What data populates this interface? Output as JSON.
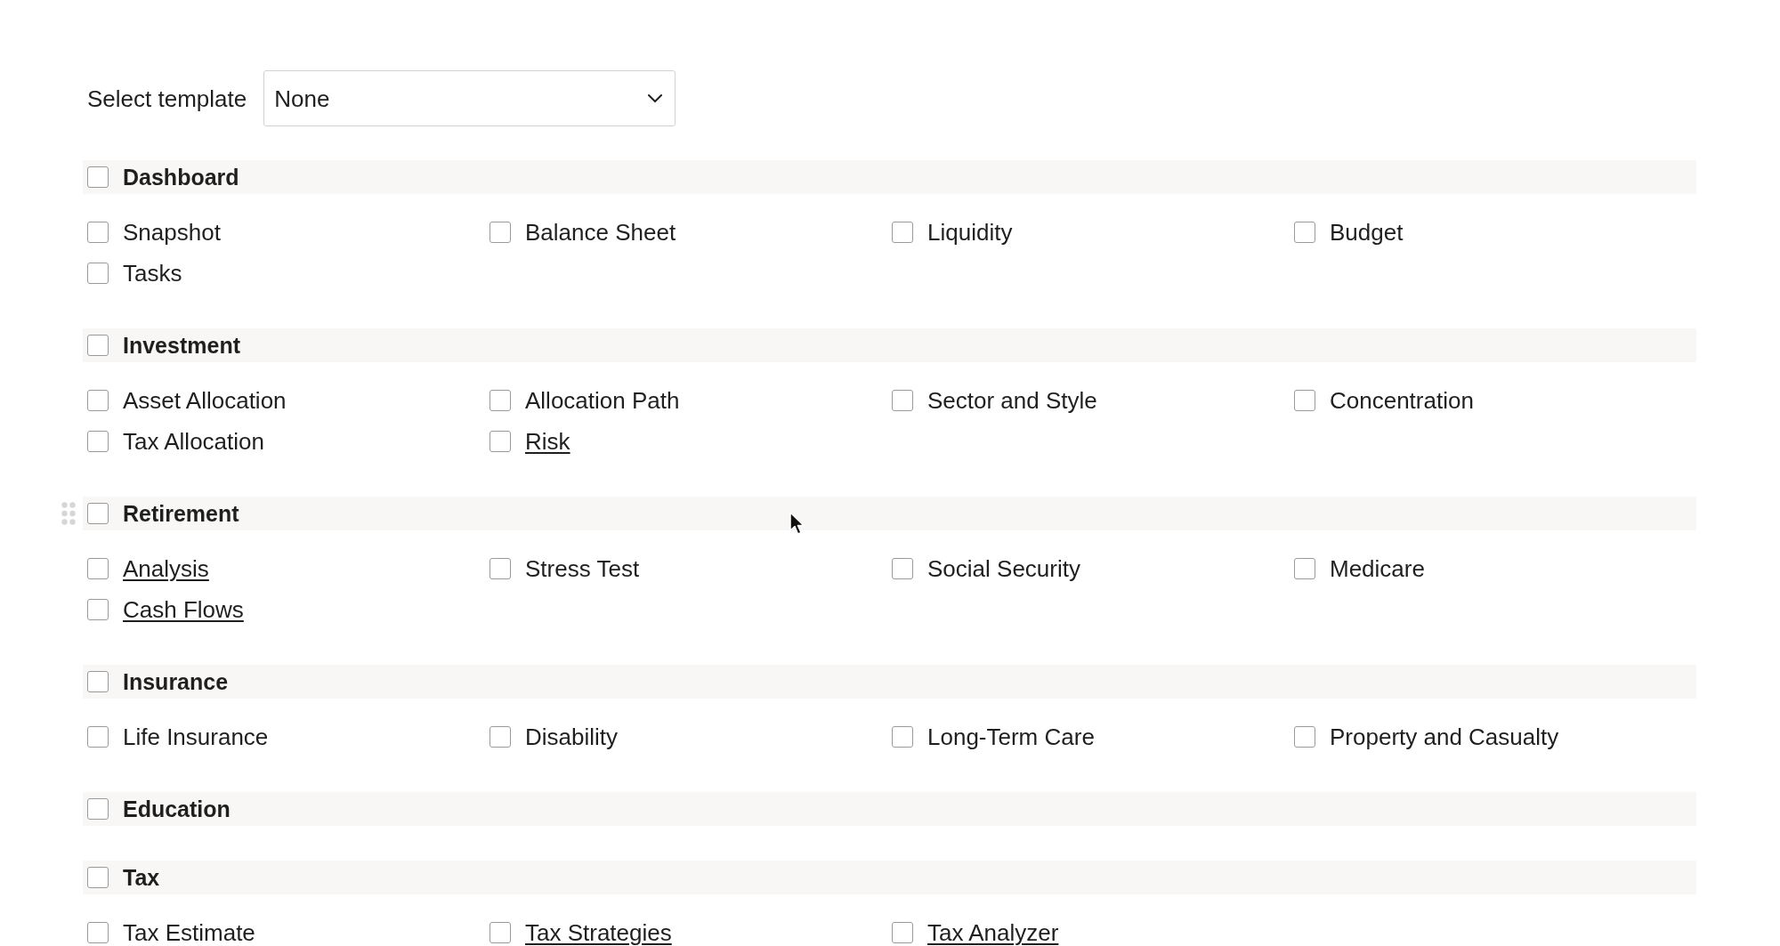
{
  "template": {
    "label": "Select template",
    "value": "None"
  },
  "sections": [
    {
      "title": "Dashboard",
      "checked": false,
      "hovered": false,
      "items": [
        {
          "label": "Snapshot",
          "checked": false,
          "linked": false
        },
        {
          "label": "Balance Sheet",
          "checked": false,
          "linked": false
        },
        {
          "label": "Liquidity",
          "checked": false,
          "linked": false
        },
        {
          "label": "Budget",
          "checked": false,
          "linked": false
        },
        {
          "label": "Tasks",
          "checked": false,
          "linked": false
        }
      ]
    },
    {
      "title": "Investment",
      "checked": false,
      "hovered": false,
      "items": [
        {
          "label": "Asset Allocation",
          "checked": false,
          "linked": false
        },
        {
          "label": "Allocation Path",
          "checked": false,
          "linked": false
        },
        {
          "label": "Sector and Style",
          "checked": false,
          "linked": false
        },
        {
          "label": "Concentration",
          "checked": false,
          "linked": false
        },
        {
          "label": "Tax Allocation",
          "checked": false,
          "linked": false
        },
        {
          "label": "Risk",
          "checked": false,
          "linked": true
        }
      ]
    },
    {
      "title": "Retirement",
      "checked": false,
      "hovered": true,
      "items": [
        {
          "label": "Analysis",
          "checked": false,
          "linked": true
        },
        {
          "label": "Stress Test",
          "checked": false,
          "linked": false
        },
        {
          "label": "Social Security",
          "checked": false,
          "linked": false
        },
        {
          "label": "Medicare",
          "checked": false,
          "linked": false
        },
        {
          "label": "Cash Flows",
          "checked": false,
          "linked": true
        }
      ]
    },
    {
      "title": "Insurance",
      "checked": false,
      "hovered": false,
      "items": [
        {
          "label": "Life Insurance",
          "checked": false,
          "linked": false
        },
        {
          "label": "Disability",
          "checked": false,
          "linked": false
        },
        {
          "label": "Long-Term Care",
          "checked": false,
          "linked": false
        },
        {
          "label": "Property and Casualty",
          "checked": false,
          "linked": false
        }
      ]
    },
    {
      "title": "Education",
      "checked": false,
      "hovered": false
    },
    {
      "title": "Tax",
      "checked": false,
      "hovered": false,
      "items": [
        {
          "label": "Tax Estimate",
          "checked": false,
          "linked": false
        },
        {
          "label": "Tax Strategies",
          "checked": false,
          "linked": true
        },
        {
          "label": "Tax Analyzer",
          "checked": false,
          "linked": true
        }
      ]
    }
  ]
}
